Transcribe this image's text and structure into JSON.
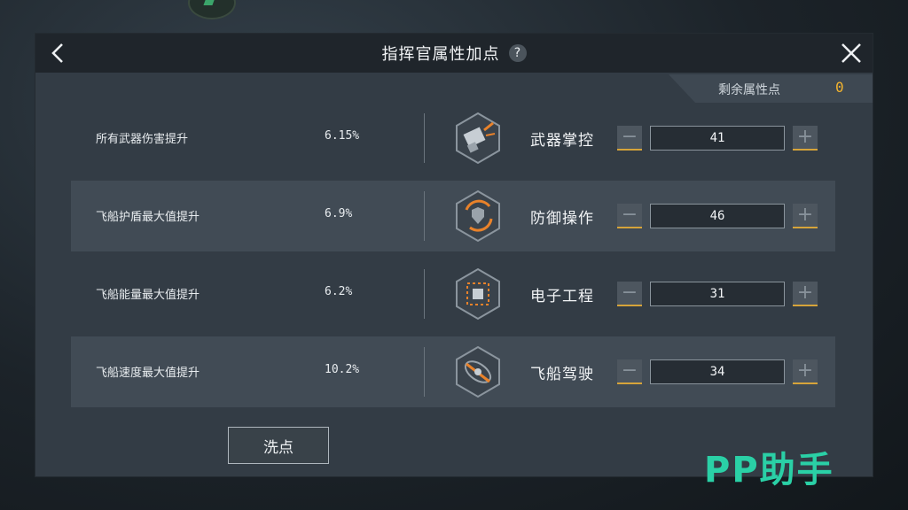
{
  "header": {
    "title": "指挥官属性加点",
    "help_glyph": "?"
  },
  "remaining": {
    "label": "剩余属性点",
    "value": "0"
  },
  "rows": [
    {
      "desc": "所有武器伤害提升",
      "pct": "6.15%",
      "name": "武器掌控",
      "value": "41",
      "icon": "weapon-control-icon"
    },
    {
      "desc": "飞船护盾最大值提升",
      "pct": "6.9%",
      "name": "防御操作",
      "value": "46",
      "icon": "shield-defense-icon"
    },
    {
      "desc": "飞船能量最大值提升",
      "pct": "6.2%",
      "name": "电子工程",
      "value": "31",
      "icon": "chip-electronics-icon"
    },
    {
      "desc": "飞船速度最大值提升",
      "pct": "10.2%",
      "name": "飞船驾驶",
      "value": "34",
      "icon": "ship-piloting-icon"
    }
  ],
  "controls": {
    "minus": "−",
    "plus": "+"
  },
  "reset_label": "洗点",
  "watermark": "PP助手",
  "colors": {
    "accent": "#f2b32e",
    "icon_orange": "#e9822a",
    "watermark": "#2ad0a6"
  }
}
